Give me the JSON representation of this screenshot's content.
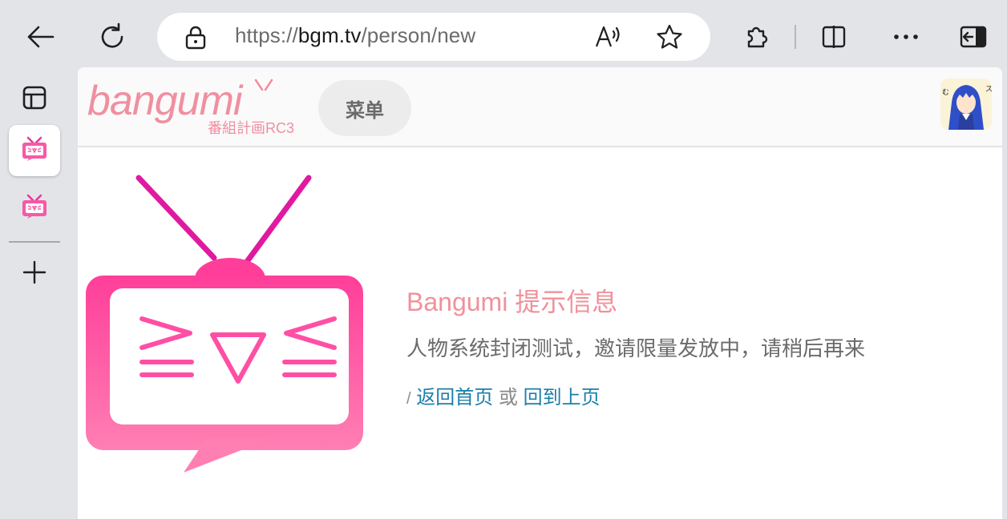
{
  "browser": {
    "url_scheme": "https://",
    "url_host": "bgm.tv",
    "url_path": "/person/new",
    "icons": [
      "back-icon",
      "refresh-icon",
      "lock-icon",
      "read-aloud-icon",
      "favorite-star-icon",
      "extensions-icon",
      "split-screen-icon",
      "more-icon",
      "sidebar-toggle-icon"
    ]
  },
  "sidebar": {
    "tabs": [
      {
        "icon": "tab-actions-icon"
      },
      {
        "icon": "bangumi-tv-icon",
        "active": true
      },
      {
        "icon": "bangumi-tv-icon"
      }
    ],
    "new_tab_icon": "plus-icon"
  },
  "site": {
    "logo_text": "bangumi",
    "logo_sub": "番組計画RC3",
    "menu_label": "菜单",
    "brand_color": "#f08fa0"
  },
  "message": {
    "title": "Bangumi 提示信息",
    "body": "人物系统封闭测试，邀请限量发放中，请稍后再来",
    "slash": "/",
    "home_link": "返回首页",
    "or": "或",
    "back_link": "回到上页",
    "link_color": "#1a7fa8"
  }
}
